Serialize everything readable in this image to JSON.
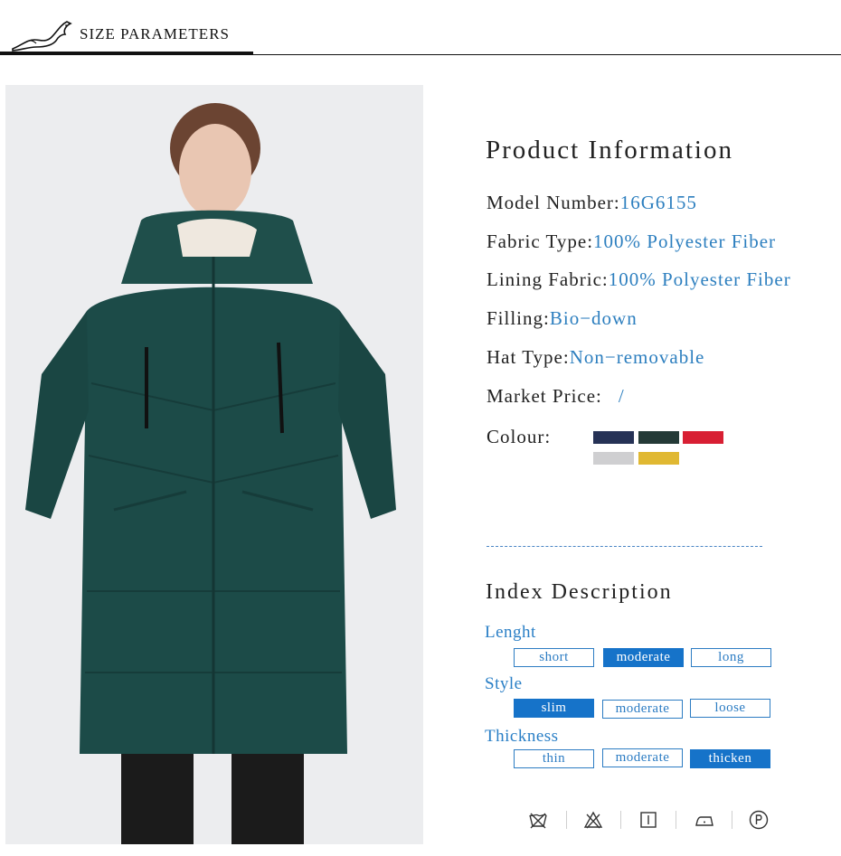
{
  "header": {
    "title": "SIZE PARAMETERS",
    "logo_icon": "fox-logo-icon"
  },
  "product_info": {
    "title": "Product Information",
    "rows": [
      {
        "label": "Model Number:",
        "value": "16G6155"
      },
      {
        "label": "Fabric Type:",
        "value": "100% Polyester Fiber"
      },
      {
        "label": "Lining Fabric:",
        "value": "100% Polyester Fiber"
      },
      {
        "label": "Filling:",
        "value": "Bio−down"
      },
      {
        "label": "Hat Type:",
        "value": "Non−removable"
      },
      {
        "label": "Market Price:",
        "value": "/"
      }
    ],
    "colour_label": "Colour:",
    "colours": [
      "#263256",
      "#243a37",
      "#d81f33",
      "#cfcfd1",
      "#e0b832"
    ]
  },
  "index_description": {
    "title": "Index Description",
    "groups": [
      {
        "label": "Lenght",
        "options": [
          "short",
          "moderate",
          "long"
        ],
        "selected": "moderate"
      },
      {
        "label": "Style",
        "options": [
          "slim",
          "moderate",
          "loose"
        ],
        "selected": "slim"
      },
      {
        "label": "Thickness",
        "options": [
          "thin",
          "moderate",
          "thicken"
        ],
        "selected": "thicken"
      }
    ]
  },
  "care_icons": [
    "no-wash-icon",
    "no-bleach-icon",
    "tumble-dry-icon",
    "iron-icon",
    "dry-clean-p-icon"
  ],
  "photo": {
    "subject": "model-photo",
    "coat_color": "#1c4b48"
  }
}
